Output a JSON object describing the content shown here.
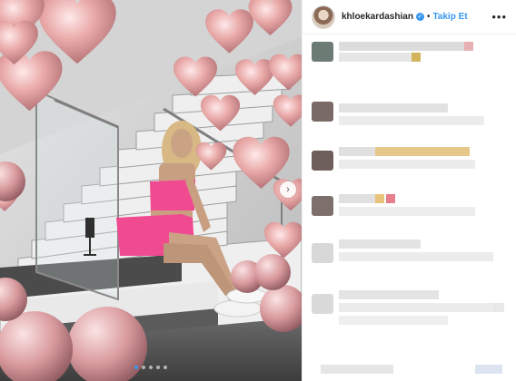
{
  "post": {
    "username": "khloekardashian",
    "follow_label": "Takip Et",
    "more_icon": "•••"
  },
  "colors": {
    "link_blue": "#3897f0",
    "text_dark": "#262626",
    "balloon_pink": "#e8a7a7",
    "outfit_pink": "#f7408c"
  },
  "carousel": {
    "slides": 5,
    "active_index": 0
  }
}
